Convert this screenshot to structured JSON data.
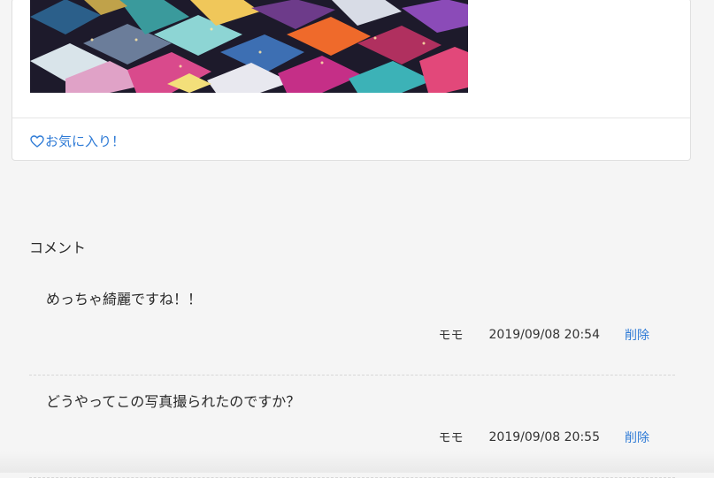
{
  "post": {
    "favorite_label": "お気に入り！",
    "heart_icon": "heart-outline-icon",
    "accent_color": "#2f7bd6"
  },
  "comments_section": {
    "heading": "コメント",
    "items": [
      {
        "body": "めっちゃ綺麗ですね！！",
        "author": "モモ",
        "date": "2019/09/08 20:54",
        "delete_label": "削除"
      },
      {
        "body": "どうやってこの写真撮られたのですか？",
        "author": "モモ",
        "date": "2019/09/08 20:55",
        "delete_label": "削除"
      }
    ]
  }
}
